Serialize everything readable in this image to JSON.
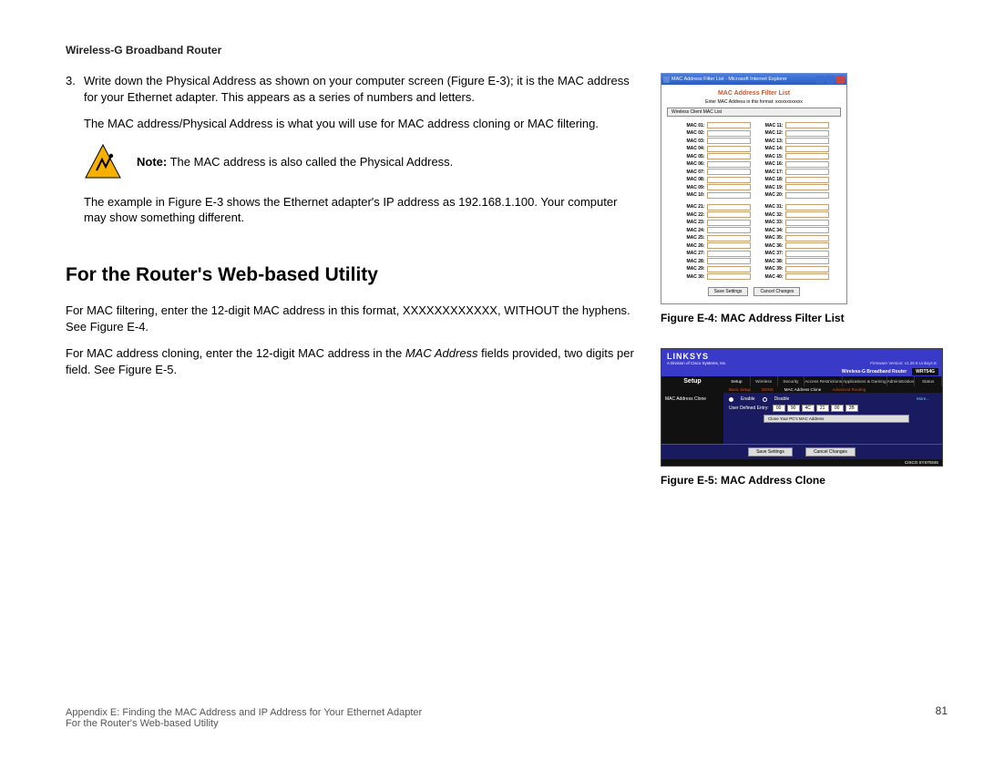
{
  "header": {
    "title": "Wireless-G Broadband Router"
  },
  "step3": {
    "num": "3.",
    "p1": "Write down the Physical Address as shown on your computer screen (Figure E-3); it is the MAC address for your Ethernet adapter. This appears as a series of numbers and letters.",
    "p2": "The MAC address/Physical Address is what you will use for MAC address cloning or MAC filtering.",
    "note_label": "Note:",
    "note_text": " The MAC address is also called the Physical Address.",
    "p3": "The example in Figure E-3 shows the Ethernet adapter's IP address as 192.168.1.100. Your computer may show something different."
  },
  "section_heading": "For the Router's Web-based Utility",
  "body": {
    "p1": "For MAC filtering, enter the 12-digit MAC address in this format, XXXXXXXXXXXX, WITHOUT the hyphens. See Figure E-4.",
    "p2_a": "For MAC address cloning, enter the 12-digit MAC address in the ",
    "p2_i": "MAC Address",
    "p2_b": " fields provided, two digits per field. See Figure E-5."
  },
  "fig_e4": {
    "win_title": "MAC Address Filter List - Microsoft Internet Explorer",
    "heading": "MAC Address Filter List",
    "sub": "Enter MAC Address in this format: xxxxxxxxxxxx",
    "top_btn": "Wireless Client MAC List",
    "col1": [
      "MAC 01:",
      "MAC 02:",
      "MAC 03:",
      "MAC 04:",
      "MAC 05:",
      "MAC 06:",
      "MAC 07:",
      "MAC 08:",
      "MAC 09:",
      "MAC 10:"
    ],
    "col2": [
      "MAC 11:",
      "MAC 12:",
      "MAC 13:",
      "MAC 14:",
      "MAC 15:",
      "MAC 16:",
      "MAC 17:",
      "MAC 18:",
      "MAC 19:",
      "MAC 20:"
    ],
    "col3": [
      "MAC 21:",
      "MAC 22:",
      "MAC 23:",
      "MAC 24:",
      "MAC 25:",
      "MAC 26:",
      "MAC 27:",
      "MAC 28:",
      "MAC 29:",
      "MAC 30:"
    ],
    "col4": [
      "MAC 31:",
      "MAC 32:",
      "MAC 33:",
      "MAC 34:",
      "MAC 35:",
      "MAC 36:",
      "MAC 37:",
      "MAC 38:",
      "MAC 39:",
      "MAC 40:"
    ],
    "save": "Save Settings",
    "cancel": "Cancel Changes",
    "caption": "Figure E-4: MAC Address Filter List"
  },
  "fig_e5": {
    "logo": "LINKSYS",
    "sublogo": "A Division of Cisco Systems, Inc.",
    "fw": "Firmware Version: v1.26 8 Linksys E",
    "bar": "Wireless-G Broadband Router",
    "model": "WRT54G",
    "setup": "Setup",
    "tabs": [
      "Setup",
      "Wireless",
      "Security",
      "Access Restrictions",
      "Applications & Gaming",
      "Administration",
      "Status"
    ],
    "subtabs": [
      "Basic Setup",
      "DDNS",
      "MAC Address Clone",
      "Advanced Routing"
    ],
    "side": "MAC Address Clone",
    "enable": "Enable",
    "disable": "Disable",
    "ude": "User Defined Entry:",
    "hex": [
      "00",
      "90",
      "4C",
      "21",
      "00",
      "2B"
    ],
    "clonebtn": "Clone Your PC's MAC Address",
    "help": "More...",
    "save": "Save Settings",
    "cancel": "Cancel Changes",
    "cisco": "CISCO SYSTEMS",
    "caption": "Figure E-5: MAC Address Clone"
  },
  "footer": {
    "line1": "Appendix E: Finding the MAC Address and IP Address for Your Ethernet Adapter",
    "line2": "For the Router's Web-based Utility",
    "page": "81"
  }
}
